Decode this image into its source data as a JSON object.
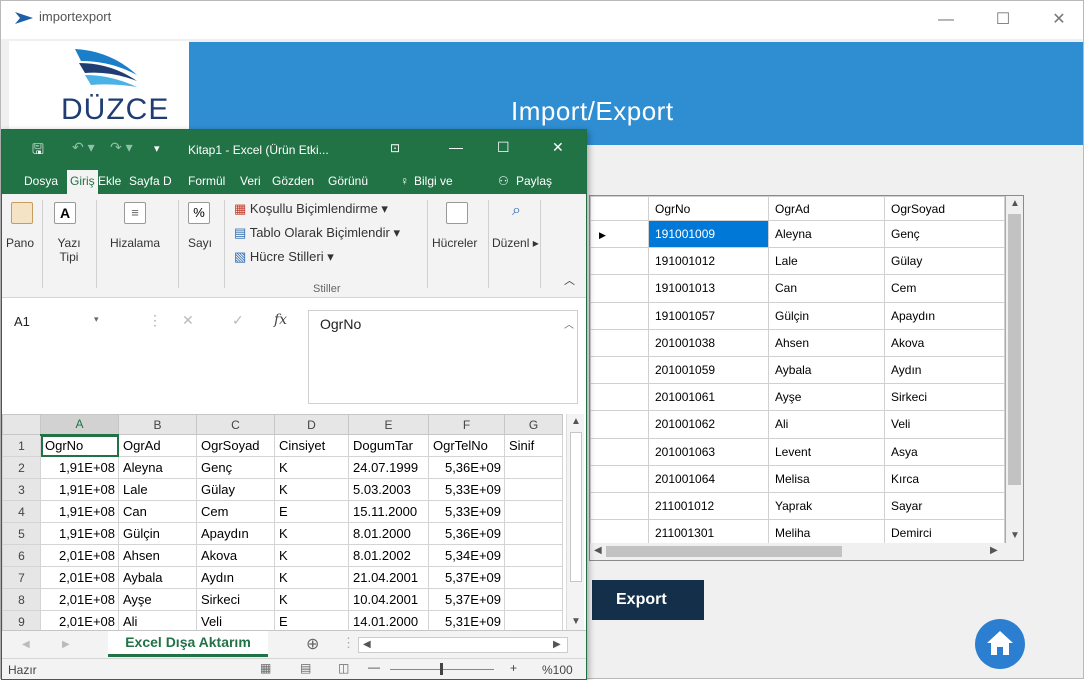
{
  "window": {
    "title": "importexport",
    "minimize": "—",
    "maximize": "☐",
    "close": "✕"
  },
  "logo": {
    "text": "DÜZCE"
  },
  "banner": {
    "title": "Import/Export"
  },
  "grid": {
    "columns": [
      "OgrNo",
      "OgrAd",
      "OgrSoyad"
    ],
    "rows": [
      [
        "191001009",
        "Aleyna",
        "Genç"
      ],
      [
        "191001012",
        "Lale",
        "Gülay"
      ],
      [
        "191001013",
        "Can",
        "Cem"
      ],
      [
        "191001057",
        "Gülçin",
        "Apaydın"
      ],
      [
        "201001038",
        "Ahsen",
        "Akova"
      ],
      [
        "201001059",
        "Aybala",
        "Aydın"
      ],
      [
        "201001061",
        "Ayşe",
        "Sirkeci"
      ],
      [
        "201001062",
        "Ali",
        "Veli"
      ],
      [
        "201001063",
        "Levent",
        "Asya"
      ],
      [
        "201001064",
        "Melisa",
        "Kırca"
      ],
      [
        "211001012",
        "Yaprak",
        "Sayar"
      ],
      [
        "211001301",
        "Meliha",
        "Demirci"
      ]
    ],
    "selected_row": 0
  },
  "export_button": {
    "label": "Export"
  },
  "excel": {
    "title": "Kitap1 - Excel (Ürün Etki...",
    "tabs": [
      "Dosya",
      "Giriş",
      "Ekle",
      "Sayfa D",
      "Formül",
      "Veri",
      "Gözden",
      "Görünü",
      "Bilgi ve",
      "Paylaş"
    ],
    "ribbon": {
      "pano": "Pano",
      "yazi_tipi": "Yazı Tipi",
      "hizalama": "Hizalama",
      "sayi": "Sayı",
      "kosullu": "Koşullu Biçimlendirme ▾",
      "tablo": "Tablo Olarak Biçimlendir ▾",
      "hucre_stilleri": "Hücre Stilleri ▾",
      "stiller": "Stiller",
      "hucreler": "Hücreler",
      "duzenle": "Düzenl ▸"
    },
    "name_box": "A1",
    "formula_value": "OgrNo",
    "col_headers": [
      "A",
      "B",
      "C",
      "D",
      "E",
      "F",
      "G"
    ],
    "rows": [
      [
        "OgrNo",
        "OgrAd",
        "OgrSoyad",
        "Cinsiyet",
        "DogumTar",
        "OgrTelNo",
        "Sinif"
      ],
      [
        "1,91E+08",
        "Aleyna",
        "Genç",
        "K",
        "24.07.1999",
        "5,36E+09",
        ""
      ],
      [
        "1,91E+08",
        "Lale",
        "Gülay",
        "K",
        "5.03.2003",
        "5,33E+09",
        ""
      ],
      [
        "1,91E+08",
        "Can",
        "Cem",
        "E",
        "15.11.2000",
        "5,33E+09",
        ""
      ],
      [
        "1,91E+08",
        "Gülçin",
        "Apaydın",
        "K",
        "8.01.2000",
        "5,36E+09",
        ""
      ],
      [
        "2,01E+08",
        "Ahsen",
        "Akova",
        "K",
        "8.01.2002",
        "5,34E+09",
        ""
      ],
      [
        "2,01E+08",
        "Aybala",
        "Aydın",
        "K",
        "21.04.2001",
        "5,37E+09",
        ""
      ],
      [
        "2,01E+08",
        "Ayşe",
        "Sirkeci",
        "K",
        "10.04.2001",
        "5,37E+09",
        ""
      ],
      [
        "2,01E+08",
        "Ali",
        "Veli",
        "E",
        "14.01.2000",
        "5,31E+09",
        ""
      ]
    ],
    "sheet_tab": "Excel Dışa Aktarım",
    "status": "Hazır",
    "zoom": "%100"
  }
}
